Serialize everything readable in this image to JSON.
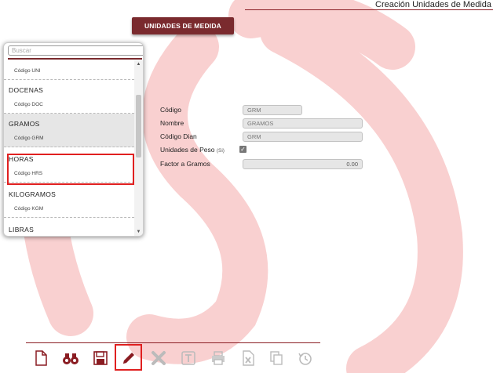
{
  "header": {
    "title": "Creación Unidades de Medida"
  },
  "section_button": {
    "label": "UNIDADES DE MEDIDA"
  },
  "search": {
    "placeholder": "Buscar"
  },
  "list": {
    "items": [
      {
        "name": "",
        "code": "Código UNI"
      },
      {
        "name": "DOCENAS",
        "code": "Código DOC"
      },
      {
        "name": "GRAMOS",
        "code": "Código GRM",
        "selected": true
      },
      {
        "name": "HORAS",
        "code": "Código HRS"
      },
      {
        "name": "KILOGRAMOS",
        "code": "Código KGM"
      },
      {
        "name": "LIBRAS",
        "code": ""
      }
    ]
  },
  "form": {
    "codigo_label": "Código",
    "codigo_value": "GRM",
    "nombre_label": "Nombre",
    "nombre_value": "GRAMOS",
    "dian_label": "Código Dian",
    "dian_value": "GRM",
    "peso_label": "Unidades de Peso",
    "peso_hint": "(Si)",
    "peso_checked": true,
    "factor_label": "Factor a Gramos",
    "factor_value": "0.00"
  },
  "toolbar": {
    "icons": [
      "new-document-icon",
      "binoculars-icon",
      "save-icon",
      "edit-pencil-icon",
      "delete-x-icon",
      "text-icon",
      "print-icon",
      "excel-icon",
      "copy-icon",
      "history-icon"
    ]
  },
  "colors": {
    "accent": "#7a2a2e",
    "highlight": "#e02020",
    "watermark": "#f7caca"
  }
}
